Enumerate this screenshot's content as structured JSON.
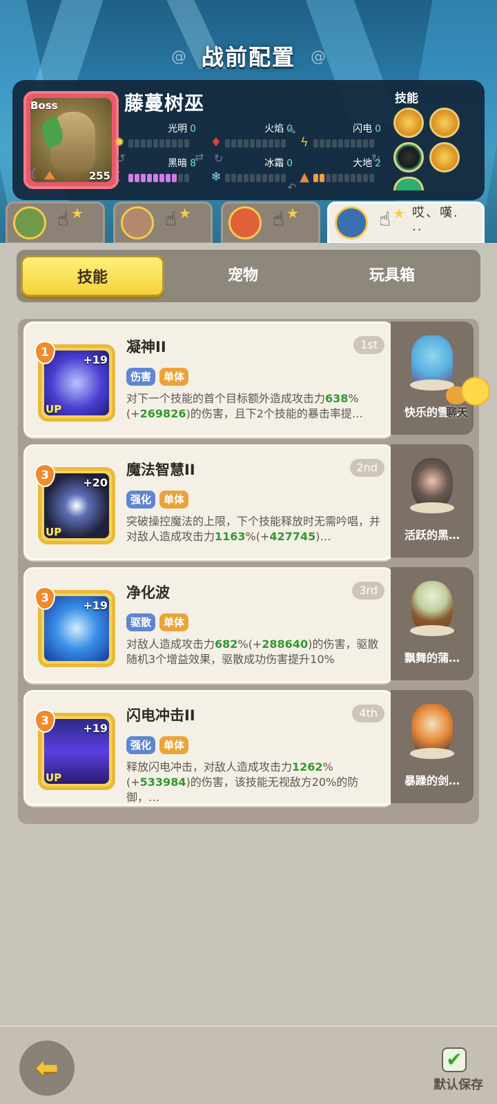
{
  "header": {
    "title": "战前配置"
  },
  "boss": {
    "tag": "Boss",
    "name": "藤蔓树巫",
    "level": "255",
    "elements": [
      {
        "name": "光明",
        "value": "0",
        "icon": "sun-icon"
      },
      {
        "name": "火焰",
        "value": "0",
        "icon": "fire-icon"
      },
      {
        "name": "闪电",
        "value": "0",
        "icon": "lightning-icon"
      },
      {
        "name": "黑暗",
        "value": "8",
        "icon": "moon-icon"
      },
      {
        "name": "冰霜",
        "value": "0",
        "icon": "snowflake-icon"
      },
      {
        "name": "大地",
        "value": "2",
        "icon": "earth-icon"
      }
    ],
    "skills_label": "技能"
  },
  "hero_tabs": [
    {
      "avatar": "hero-avatar-1",
      "text": ""
    },
    {
      "avatar": "hero-avatar-2",
      "text": ""
    },
    {
      "avatar": "hero-avatar-3",
      "text": ""
    },
    {
      "avatar": "hero-avatar-4",
      "text": "哎、嘆.\n.."
    }
  ],
  "tabs": {
    "skill": "技能",
    "pet": "宠物",
    "toybox": "玩具箱"
  },
  "skills": [
    {
      "level": "1",
      "plus": "+19",
      "up": "UP",
      "name": "凝神II",
      "rank": "1st",
      "tags": [
        "伤害",
        "单体"
      ],
      "desc_a": "对下一个技能的首个目标额外造成攻击力",
      "desc_b": "638",
      "desc_c": "%(+",
      "desc_d": "269826",
      "desc_e": ")的伤害，且下2个技能的暴击率提…",
      "pet": "快乐的雪…"
    },
    {
      "level": "3",
      "plus": "+20",
      "up": "UP",
      "name": "魔法智慧II",
      "rank": "2nd",
      "tags": [
        "强化",
        "单体"
      ],
      "desc_a": "突破操控魔法的上限，下个技能释放时无需吟唱，并对敌人造成攻击力",
      "desc_b": "1163",
      "desc_c": "%(+",
      "desc_d": "427745",
      "desc_e": ")…",
      "pet": "活跃的黑…"
    },
    {
      "level": "3",
      "plus": "+19",
      "up": "",
      "name": "净化波",
      "rank": "3rd",
      "tags": [
        "驱散",
        "单体"
      ],
      "desc_a": "对敌人造成攻击力",
      "desc_b": "682",
      "desc_c": "%(+",
      "desc_d": "288640",
      "desc_e": ")的伤害，驱散随机3个增益效果，驱散成功伤害提升10%",
      "pet": "飘舞的蒲…"
    },
    {
      "level": "3",
      "plus": "+19",
      "up": "UP",
      "name": "闪电冲击II",
      "rank": "4th",
      "tags": [
        "强化",
        "单体"
      ],
      "desc_a": "释放闪电冲击，对敌人造成攻击力",
      "desc_b": "1262",
      "desc_c": "%(+",
      "desc_d": "533984",
      "desc_e": ")的伤害，该技能无视敌方20%的防御，…",
      "pet": "暴躁的剑…"
    }
  ],
  "chat": {
    "label": "聊天"
  },
  "footer": {
    "save_label": "默认保存"
  }
}
